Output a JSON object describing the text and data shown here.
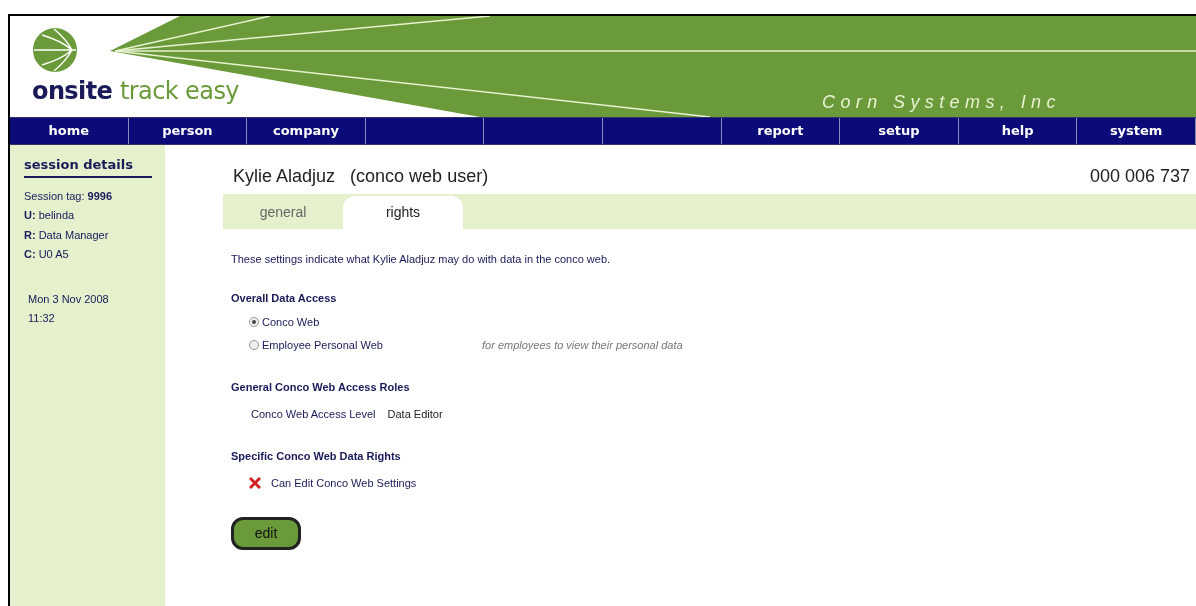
{
  "brand": {
    "name_strong": "onsite",
    "name_light": "track easy",
    "company": "Corn Systems, Inc"
  },
  "nav": {
    "left": [
      {
        "label": "home"
      },
      {
        "label": "person"
      },
      {
        "label": "company"
      }
    ],
    "right": [
      {
        "label": "report"
      },
      {
        "label": "setup"
      },
      {
        "label": "help"
      },
      {
        "label": "system"
      }
    ]
  },
  "sidebar": {
    "title": "session details",
    "lines": [
      {
        "label": "Session tag:",
        "value": "9996"
      },
      {
        "label": "U:",
        "value": "belinda"
      },
      {
        "label": "R:",
        "value": "Data Manager"
      },
      {
        "label": "C:",
        "value": "U0 A5"
      }
    ],
    "date": "Mon 3 Nov 2008",
    "time": "11:32"
  },
  "person": {
    "name": "Kylie Aladjuz",
    "role": "(conco web user)",
    "number": "000 006 737"
  },
  "tabs": [
    {
      "label": "general",
      "selected": false
    },
    {
      "label": "rights",
      "selected": true
    }
  ],
  "intro": "These settings indicate what Kylie Aladjuz may do with data in the conco web.",
  "overall": {
    "heading": "Overall Data Access",
    "options": [
      {
        "label": "Conco Web",
        "selected": true
      },
      {
        "label": "Employee Personal Web",
        "selected": false,
        "note": "for employees to view their personal data"
      }
    ]
  },
  "roles": {
    "heading": "General Conco Web Access Roles",
    "items": [
      {
        "label": "Conco Web Access Level",
        "value": "Data Editor"
      }
    ]
  },
  "rights": {
    "heading": "Specific Conco Web Data Rights",
    "items": [
      {
        "label": "Can Edit Conco Web Settings",
        "granted": false
      }
    ]
  },
  "button": "edit"
}
